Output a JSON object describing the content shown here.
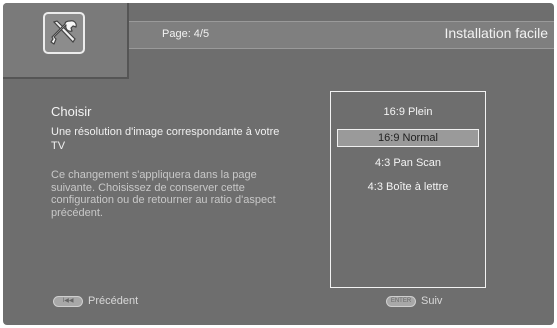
{
  "header": {
    "page": "Page: 4/5",
    "title": "Installation facile"
  },
  "content": {
    "heading": "Choisir",
    "subheading": "Une résolution d'image correspondante à votre TV",
    "note": "Ce changement s'appliquera dans la page suivante. Choisissez de conserver cette configuration ou de retourner au ratio d'aspect précédent."
  },
  "options": [
    {
      "label": "16:9 Plein",
      "selected": false
    },
    {
      "label": "16:9 Normal",
      "selected": true
    },
    {
      "label": "4:3 Pan Scan",
      "selected": false
    },
    {
      "label": "4:3 Boîte à lettre",
      "selected": false
    }
  ],
  "footer": {
    "back_key": "I◀◀",
    "back_label": "Précédent",
    "next_key": "ENTER",
    "next_label": "Suiv"
  },
  "icons": {
    "setup": "wrench-screwdriver-icon"
  }
}
